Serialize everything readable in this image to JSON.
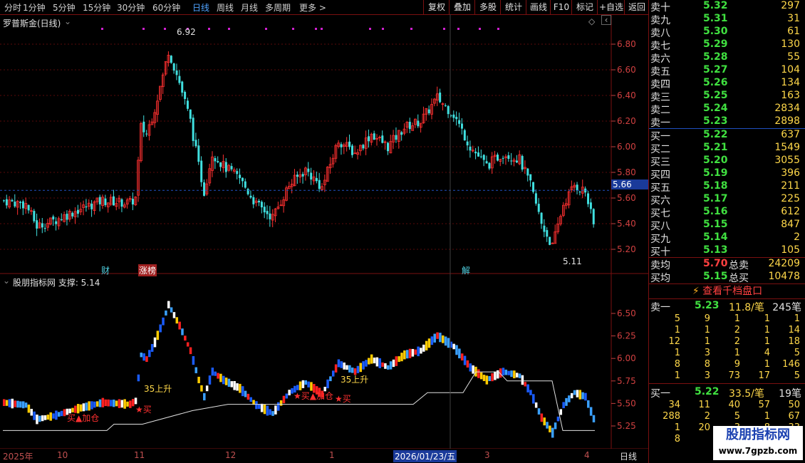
{
  "toolbar": {
    "periods": [
      "分时",
      "1分钟",
      "5分钟",
      "15分钟",
      "30分钟",
      "60分钟",
      "日线",
      "周线",
      "月线",
      "多周期",
      "更多 >"
    ],
    "active_period": "日线",
    "buttons": [
      "复权",
      "叠加",
      "多股",
      "统计",
      "画线",
      "F10",
      "标记",
      "+自选",
      "返回"
    ]
  },
  "main_chart": {
    "title": "罗普斯金(日线)",
    "high_label": "6.92",
    "low_label": "5.11",
    "current_price": "5.66",
    "y_ticks": [
      "6.80",
      "6.60",
      "6.40",
      "6.20",
      "6.00",
      "5.80",
      "5.60",
      "5.40",
      "5.20"
    ],
    "event_tags": [
      "财",
      "涨榜",
      "解"
    ]
  },
  "indicator": {
    "title": "股朋指标网 支撑: 5.14",
    "y_ticks": [
      "6.50",
      "6.25",
      "6.00",
      "5.75",
      "5.50",
      "5.25"
    ],
    "annotations": [
      "35上升",
      "买▲加仓",
      "★买▲加仓",
      "★买",
      "35上升",
      "★买"
    ]
  },
  "x_axis": {
    "labels": [
      "2025年",
      "10",
      "11",
      "12",
      "1",
      "2026/01/23/五",
      "3",
      "4"
    ],
    "period_button": "日线"
  },
  "orderbook": {
    "asks": [
      {
        "label": "卖十",
        "price": "5.32",
        "vol": "297"
      },
      {
        "label": "卖九",
        "price": "5.31",
        "vol": "31"
      },
      {
        "label": "卖八",
        "price": "5.30",
        "vol": "61"
      },
      {
        "label": "卖七",
        "price": "5.29",
        "vol": "130"
      },
      {
        "label": "卖六",
        "price": "5.28",
        "vol": "55"
      },
      {
        "label": "卖五",
        "price": "5.27",
        "vol": "104"
      },
      {
        "label": "卖四",
        "price": "5.26",
        "vol": "134"
      },
      {
        "label": "卖三",
        "price": "5.25",
        "vol": "163"
      },
      {
        "label": "卖二",
        "price": "5.24",
        "vol": "2834"
      },
      {
        "label": "卖一",
        "price": "5.23",
        "vol": "2898"
      }
    ],
    "bids": [
      {
        "label": "买一",
        "price": "5.22",
        "vol": "637"
      },
      {
        "label": "买二",
        "price": "5.21",
        "vol": "1549"
      },
      {
        "label": "买三",
        "price": "5.20",
        "vol": "3055"
      },
      {
        "label": "买四",
        "price": "5.19",
        "vol": "396"
      },
      {
        "label": "买五",
        "price": "5.18",
        "vol": "211"
      },
      {
        "label": "买六",
        "price": "5.17",
        "vol": "225"
      },
      {
        "label": "买七",
        "price": "5.16",
        "vol": "612"
      },
      {
        "label": "买八",
        "price": "5.15",
        "vol": "847"
      },
      {
        "label": "买九",
        "price": "5.14",
        "vol": "2"
      },
      {
        "label": "买十",
        "price": "5.13",
        "vol": "105"
      }
    ],
    "avg_sell": {
      "label": "卖均",
      "price": "5.70",
      "total_label": "总卖",
      "total": "24209"
    },
    "avg_buy": {
      "label": "买均",
      "price": "5.15",
      "total_label": "总买",
      "total": "10478"
    },
    "view_button": "查看千档盘口",
    "sell1_queue": {
      "label": "卖一",
      "price": "5.23",
      "per": "11.8/笔",
      "count": "245笔",
      "rows": [
        [
          "5",
          "9",
          "1",
          "1",
          "1"
        ],
        [
          "1",
          "1",
          "2",
          "1",
          "14"
        ],
        [
          "12",
          "1",
          "2",
          "1",
          "18"
        ],
        [
          "1",
          "3",
          "1",
          "4",
          "5"
        ],
        [
          "8",
          "8",
          "9",
          "1",
          "146"
        ],
        [
          "1",
          "3",
          "73",
          "17",
          "5"
        ]
      ]
    },
    "buy1_queue": {
      "label": "买一",
      "price": "5.22",
      "per": "33.5/笔",
      "count": "19笔",
      "rows": [
        [
          "34",
          "11",
          "40",
          "57",
          "50"
        ],
        [
          "288",
          "2",
          "5",
          "1",
          "67"
        ],
        [
          "1",
          "20",
          "3",
          "8",
          "33"
        ],
        [
          "8",
          "",
          "",
          "",
          ""
        ]
      ]
    },
    "watermark": "股朋指标网",
    "watermark_url": "www.7gpzb.com"
  }
}
